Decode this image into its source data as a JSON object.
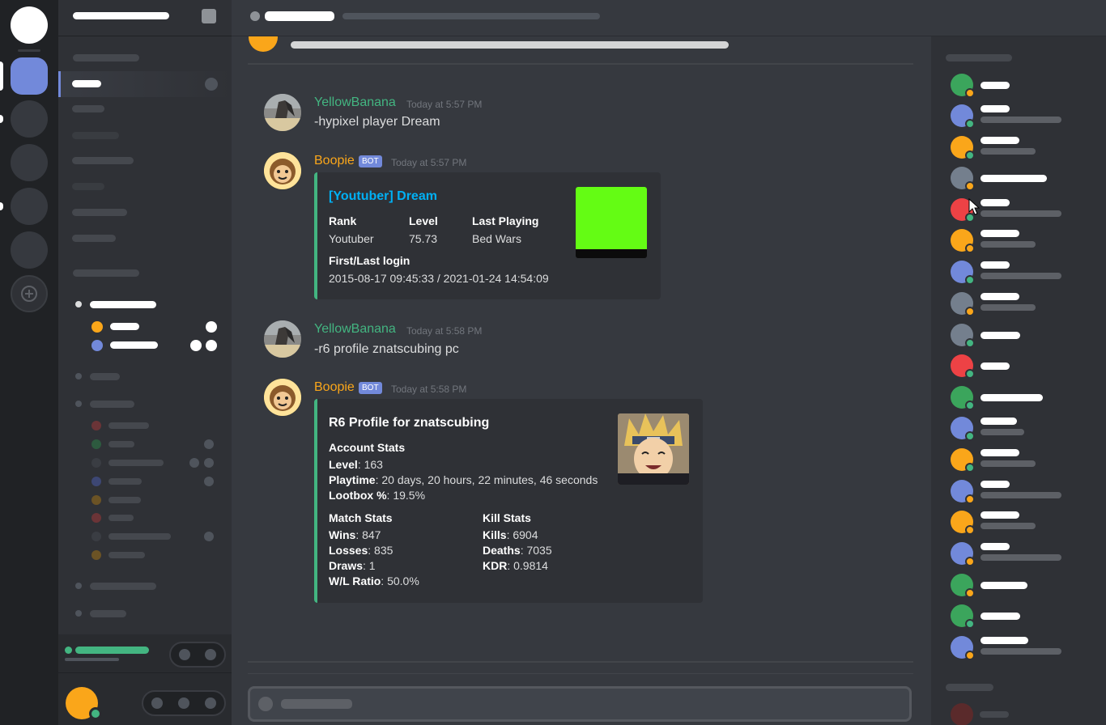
{
  "messages": [
    {
      "author": "YellowBanana",
      "timestamp": "Today at 5:57 PM",
      "text": "-hypixel player Dream"
    },
    {
      "author": "Boopie",
      "bot_tag": "BOT",
      "timestamp": "Today at 5:57 PM"
    },
    {
      "author": "YellowBanana",
      "timestamp": "Today at 5:58 PM",
      "text": "-r6 profile znatscubing pc"
    },
    {
      "author": "Boopie",
      "bot_tag": "BOT",
      "timestamp": "Today at 5:58 PM"
    }
  ],
  "embed1": {
    "title": "[Youtuber] Dream",
    "fields": [
      {
        "name": "Rank",
        "value": "Youtuber"
      },
      {
        "name": "Level",
        "value": "75.73"
      },
      {
        "name": "Last Playing",
        "value": "Bed Wars"
      }
    ],
    "login_label": "First/Last login",
    "login_value": "2015-08-17 09:45:33 / 2021-01-24 14:54:09",
    "thumbnail_color": "#64fc14"
  },
  "embed2": {
    "title": "R6 Profile for znatscubing",
    "account_header": "Account Stats",
    "account": [
      {
        "k": "Level",
        "v": ": 163"
      },
      {
        "k": "Playtime",
        "v": ": 20 days, 20 hours, 22 minutes, 46 seconds"
      },
      {
        "k": "Lootbox %",
        "v": ": 19.5%"
      }
    ],
    "match_header": "Match Stats",
    "match": [
      {
        "k": "Wins",
        "v": ": 847"
      },
      {
        "k": "Losses",
        "v": ": 835"
      },
      {
        "k": "Draws",
        "v": ": 1"
      },
      {
        "k": "W/L Ratio",
        "v": ": 50.0%"
      }
    ],
    "kill_header": "Kill Stats",
    "kill": [
      {
        "k": "Kills",
        "v": ": 6904"
      },
      {
        "k": "Deaths",
        "v": ": 7035"
      },
      {
        "k": "KDR",
        "v": ": 0.9814"
      }
    ]
  },
  "colors": {
    "yellowbanana": "#43b581",
    "boopie": "#faa61a",
    "link": "#00b0f4",
    "embed_border": "#43b581",
    "online": "#43b581",
    "idle": "#faa61a",
    "dnd": "#f04747",
    "blurple": "#7289da"
  },
  "members": [
    {
      "avatar": "#3ba55c",
      "status": "#faa61a"
    },
    {
      "avatar": "#7289da",
      "status": "#43b581"
    },
    {
      "avatar": "#faa61a",
      "status": "#43b581"
    },
    {
      "avatar": "#747f8d",
      "status": "#faa61a"
    },
    {
      "avatar": "#ed4245",
      "status": "#43b581"
    },
    {
      "avatar": "#faa61a",
      "status": "#faa61a"
    },
    {
      "avatar": "#7289da",
      "status": "#43b581"
    },
    {
      "avatar": "#747f8d",
      "status": "#faa61a"
    },
    {
      "avatar": "#747f8d",
      "status": "#43b581"
    },
    {
      "avatar": "#ed4245",
      "status": "#43b581"
    },
    {
      "avatar": "#3ba55c",
      "status": "#43b581"
    },
    {
      "avatar": "#7289da",
      "status": "#43b581"
    },
    {
      "avatar": "#faa61a",
      "status": "#43b581"
    },
    {
      "avatar": "#7289da",
      "status": "#faa61a"
    },
    {
      "avatar": "#faa61a",
      "status": "#faa61a"
    },
    {
      "avatar": "#7289da",
      "status": "#faa61a"
    },
    {
      "avatar": "#3ba55c",
      "status": "#faa61a"
    },
    {
      "avatar": "#3ba55c",
      "status": "#43b581"
    },
    {
      "avatar": "#7289da",
      "status": "#faa61a"
    }
  ]
}
